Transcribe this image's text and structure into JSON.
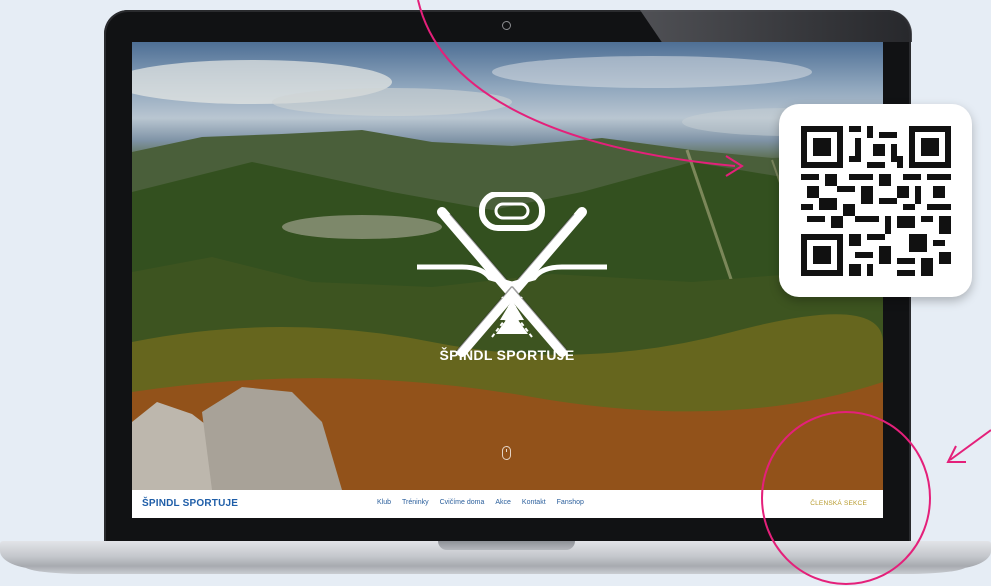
{
  "site": {
    "hero_title": "ŠPINDL SPORTUJE",
    "nav_brand": "ŠPINDL SPORTUJE",
    "nav_items": [
      "Klub",
      "Tréninky",
      "Cvičíme doma",
      "Akce",
      "Kontakt",
      "Fanshop"
    ],
    "members_link": "ČLENSKÁ SEKCE"
  },
  "colors": {
    "annotation": "#e4207a",
    "nav_text": "#2b5f9c",
    "brand_blue": "#1f5ea8",
    "members_gold": "#b79a2c",
    "laptop_bezel": "#111214"
  },
  "icons": {
    "hero_logo": "ski-goggles-crossed-skis-tree-logo",
    "scroll_hint": "scroll-mouse-icon",
    "qr": "qr-code"
  }
}
